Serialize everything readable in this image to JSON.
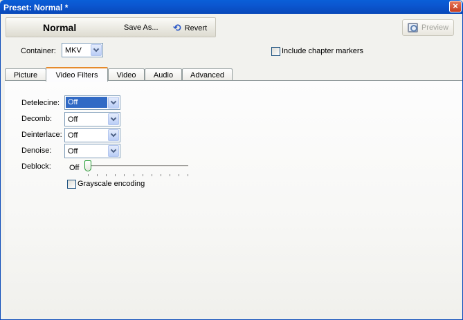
{
  "window": {
    "title": "Preset: Normal *",
    "close_glyph": "×"
  },
  "toolbar": {
    "preset_name": "Normal",
    "save_as_label": "Save As...",
    "revert_label": "Revert",
    "revert_icon": "undo-arrow",
    "preview_label": "Preview",
    "preview_icon": "preview-magnifier"
  },
  "container": {
    "label": "Container:",
    "value": "MKV"
  },
  "chapters": {
    "label": "Include chapter markers",
    "checked": false
  },
  "tabs": [
    {
      "label": "Picture",
      "active": false
    },
    {
      "label": "Video Filters",
      "active": true
    },
    {
      "label": "Video",
      "active": false
    },
    {
      "label": "Audio",
      "active": false
    },
    {
      "label": "Advanced",
      "active": false
    }
  ],
  "filters": {
    "detelecine": {
      "label": "Detelecine:",
      "value": "Off"
    },
    "decomb": {
      "label": "Decomb:",
      "value": "Off"
    },
    "deinterlace": {
      "label": "Deinterlace:",
      "value": "Off"
    },
    "denoise": {
      "label": "Denoise:",
      "value": "Off"
    },
    "deblock": {
      "label": "Deblock:",
      "value": "Off",
      "level": 0
    },
    "grayscale": {
      "label": "Grayscale encoding",
      "checked": false
    }
  },
  "colors": {
    "titlebar": "#0b56d0",
    "tab_accent": "#e68b2c",
    "selection": "#316ac5",
    "slider_thumb_border": "#1f9a2f"
  }
}
